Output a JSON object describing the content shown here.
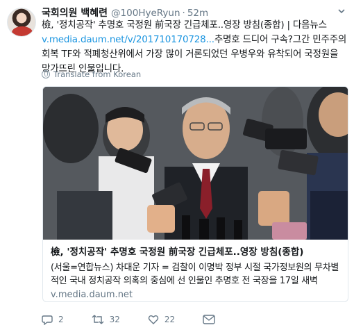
{
  "tweet": {
    "author_name": "국회의원 백혜련",
    "handle": "@100HyeRyun",
    "separator": "·",
    "time": "52m",
    "text_before_link": "檢, '정치공작' 추명호 국정원 前국장 긴급체포..영장 방침(종합) | 다음뉴스 ",
    "link": "v.media.daum.net/v/201710170728...",
    "text_after_link": "추명호 드디어 구속?그간 민주주의회복 TF와 적폐청산위에서  가장 많이 거론되었던 우병우와 유착되어 국정원을 망가뜨린 인물입니다.",
    "translate_label": "Translate from Korean"
  },
  "card": {
    "title": "檢, '정치공작' 추명호 국정원 前국장 긴급체포..영장 방침(종합)",
    "description": "(서울=연합뉴스) 차대운 기자 = 검찰이 이명박 정부 시절 국가정보원의 무차별적인 국내 정치공작 의혹의 중심에 선 인물인 추명호 전 국장을 17일 새벽",
    "domain": "v.media.daum.net"
  },
  "actions": {
    "replies": "2",
    "retweets": "32",
    "likes": "22"
  },
  "colors": {
    "link": "#1b95e0",
    "muted": "#657786",
    "border": "#e1e8ed"
  }
}
